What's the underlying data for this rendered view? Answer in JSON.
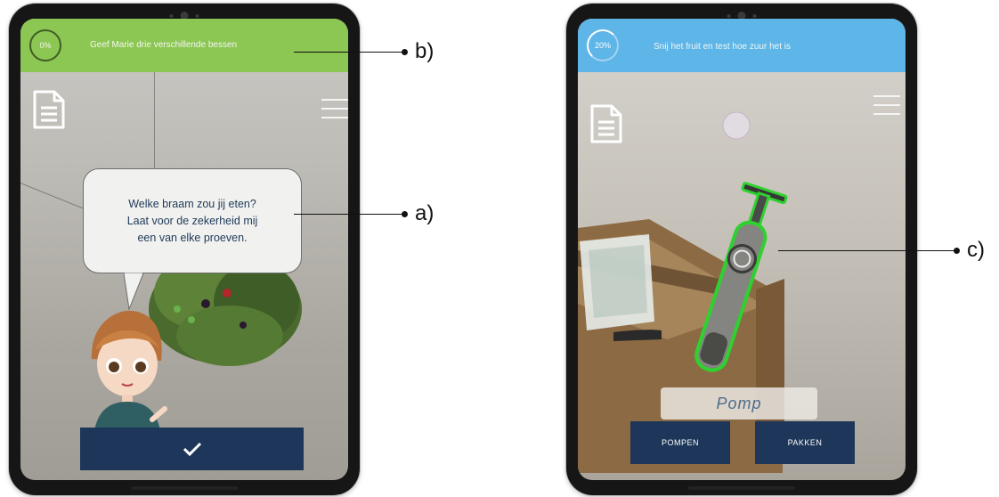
{
  "left_screen": {
    "progress": "0%",
    "task": "Geef Marie drie verschillende bessen",
    "speech_lines": [
      "Welke braam zou jij eten?",
      "Laat voor de zekerheid mij",
      "een van elke proeven."
    ],
    "confirm_icon": "checkmark-icon",
    "header_color": "#8cc653"
  },
  "right_screen": {
    "progress": "20%",
    "task": "Snij het fruit en test hoe zuur het is",
    "object_label": "Pomp",
    "buttons": [
      "POMPEN",
      "PAKKEN"
    ],
    "header_color": "#5db5e8",
    "highlight_color": "#2fd12f"
  },
  "callouts": {
    "a": "a)",
    "b": "b)",
    "c": "c)"
  },
  "button_color": "#1d3659"
}
